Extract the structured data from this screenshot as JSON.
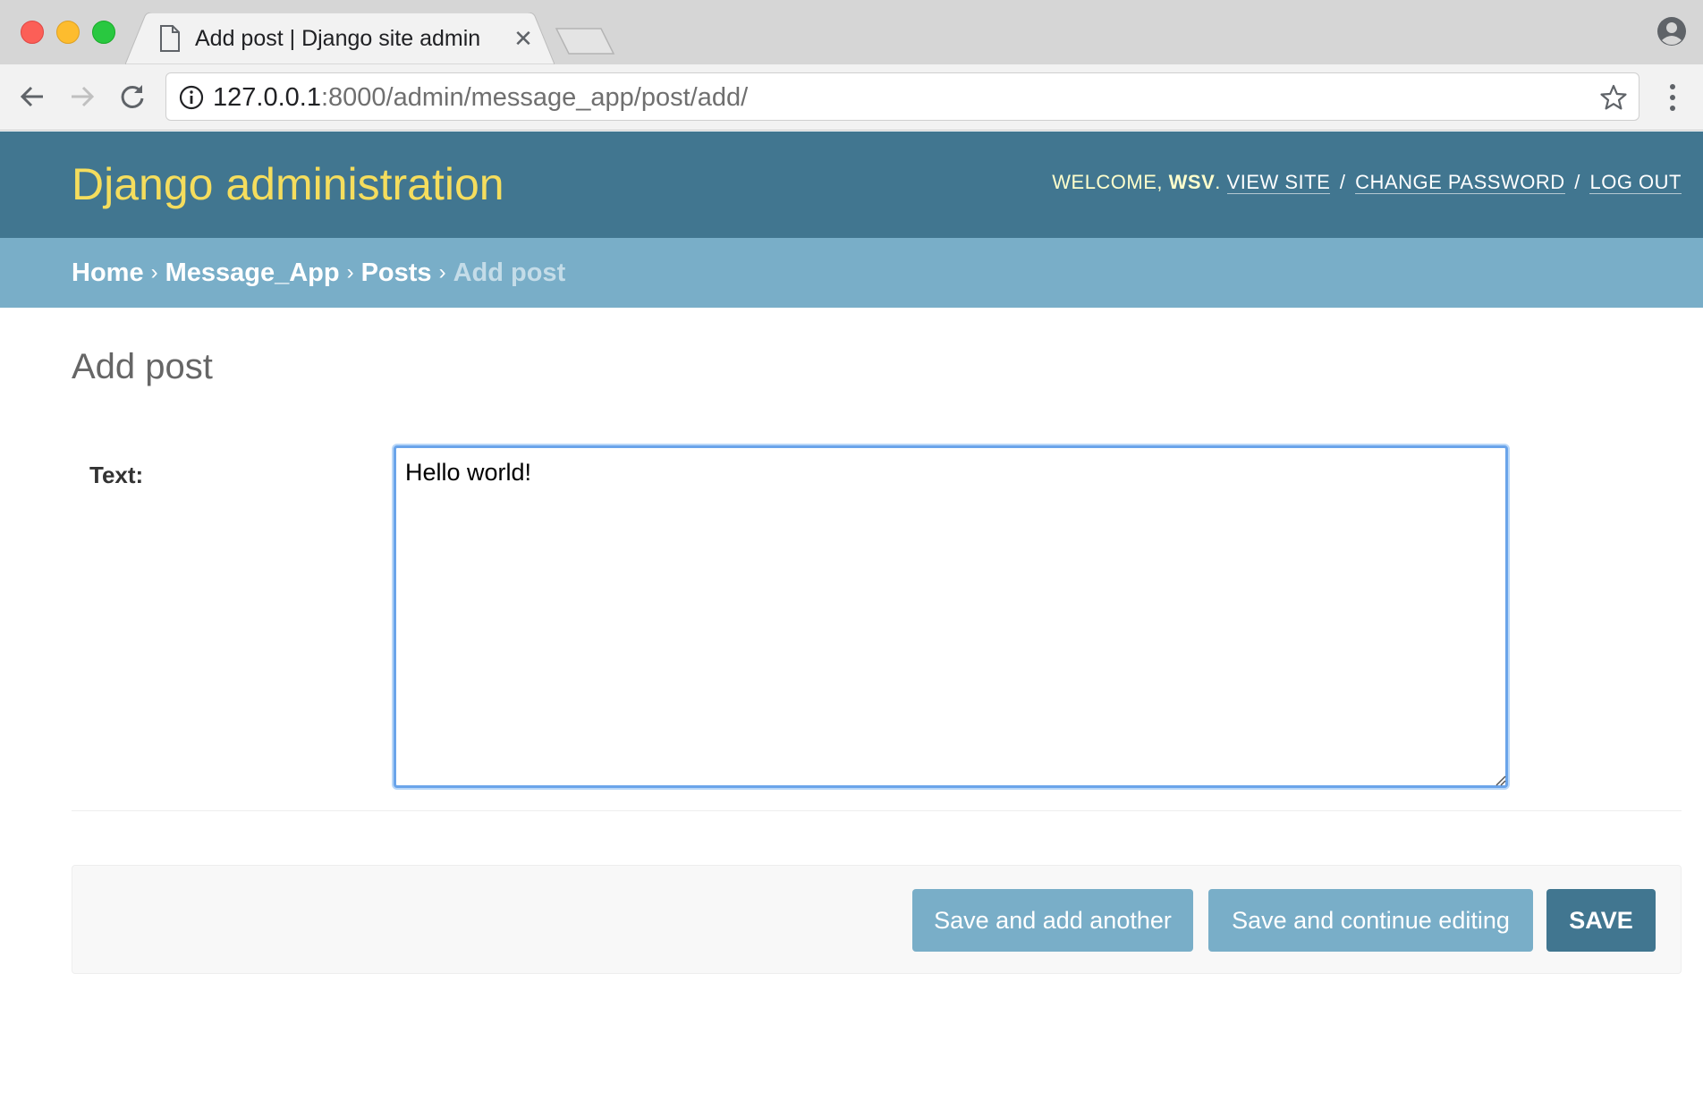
{
  "browser": {
    "tab": {
      "title": "Add post | Django site admin"
    },
    "address_bar": {
      "host": "127.0.0.1",
      "path": ":8000/admin/message_app/post/add/"
    }
  },
  "admin": {
    "branding": "Django administration",
    "user_tools": {
      "welcome": "WELCOME, ",
      "username": "WSV",
      "after_username": ".",
      "view_site": "VIEW SITE",
      "change_password": "CHANGE PASSWORD",
      "log_out": "LOG OUT",
      "separator": "/"
    },
    "breadcrumbs": {
      "home": "Home",
      "app": "Message_App",
      "model": "Posts",
      "current": "Add post",
      "arrow": "›"
    },
    "page_title": "Add post",
    "form": {
      "text_label": "Text:",
      "text_value": "Hello world!"
    },
    "buttons": {
      "save_add_another": "Save and add another",
      "save_continue": "Save and continue editing",
      "save": "SAVE"
    }
  },
  "colors": {
    "header_bg": "#417690",
    "branding": "#f5dd5d",
    "breadcrumbs_bg": "#79aec8",
    "button_secondary": "#79aec8",
    "button_primary": "#417690",
    "focus_ring": "#6aa4ea"
  },
  "icons": {
    "tab_page": "page-icon",
    "tab_close": "close-icon",
    "back": "arrow-left-icon",
    "forward": "arrow-right-icon",
    "reload": "reload-icon",
    "info": "info-icon",
    "bookmark": "star-icon",
    "menu": "vertical-dots-icon",
    "profile": "profile-icon"
  }
}
